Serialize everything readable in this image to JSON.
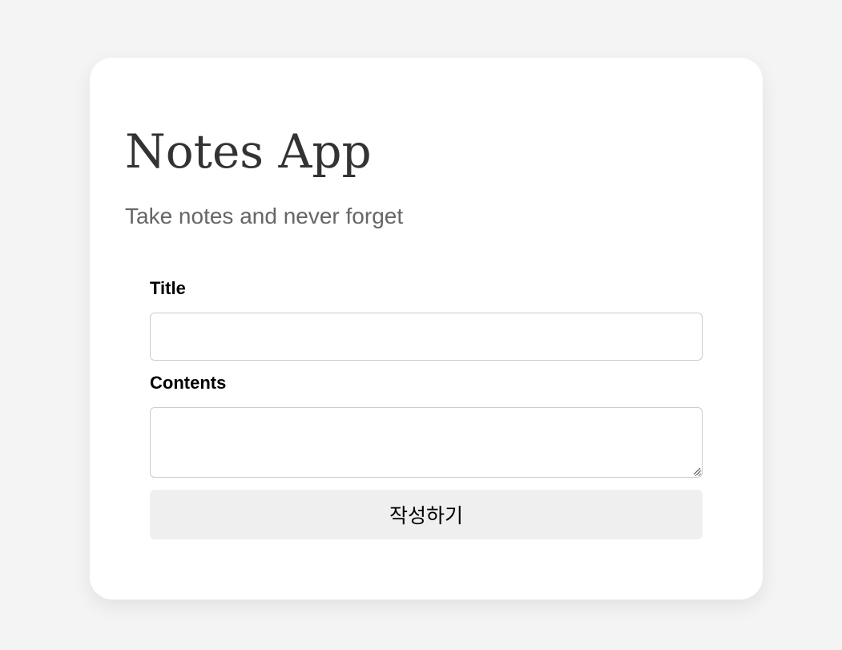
{
  "header": {
    "title": "Notes App",
    "subtitle": "Take notes and never forget"
  },
  "form": {
    "title_label": "Title",
    "title_value": "",
    "contents_label": "Contents",
    "contents_value": "",
    "submit_label": "작성하기"
  },
  "colors": {
    "page_background": "#f4f4f4",
    "card_background": "#ffffff",
    "title_text": "#333333",
    "subtitle_text": "#666666",
    "button_background": "#efefef",
    "input_border": "#cccccc"
  },
  "icons": {
    "textarea_resize": "resize-grip-icon"
  }
}
